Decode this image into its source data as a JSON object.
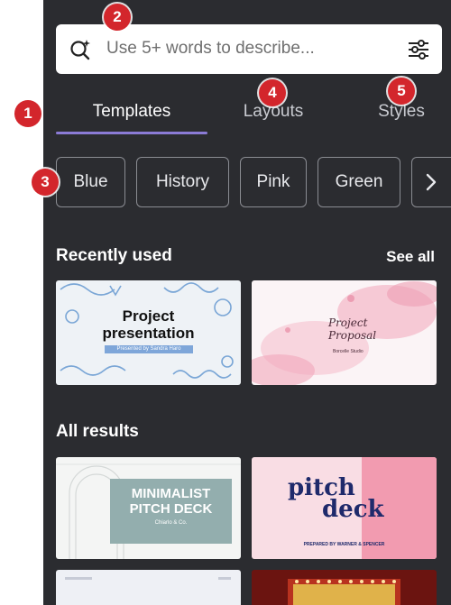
{
  "search": {
    "placeholder": "Use 5+ words to describe..."
  },
  "tabs": [
    {
      "label": "Templates",
      "active": true
    },
    {
      "label": "Layouts",
      "active": false
    },
    {
      "label": "Styles",
      "active": false
    }
  ],
  "chips": [
    "Blue",
    "History",
    "Pink",
    "Green"
  ],
  "recently_used": {
    "title": "Recently used",
    "see_all": "See all",
    "items": [
      {
        "title_line1": "Project",
        "title_line2": "presentation",
        "subtitle": "Presented by Sandra Haro"
      },
      {
        "title_line1": "Project",
        "title_line2": "Proposal",
        "subtitle": "Borcelle Studio"
      }
    ]
  },
  "all_results": {
    "title": "All results",
    "items": [
      {
        "title_line1": "MINIMALIST",
        "title_line2": "PITCH DECK",
        "subtitle": "Chiarlo & Co."
      },
      {
        "title_line1": "pitch",
        "title_line2": "deck",
        "subtitle": "PREPARED BY WARNER & SPENCER"
      }
    ]
  },
  "callouts": [
    "1",
    "2",
    "3",
    "4",
    "5"
  ],
  "colors": {
    "panel_bg": "#2b2c30",
    "accent": "#8b7bd6",
    "callout": "#d3262c"
  }
}
